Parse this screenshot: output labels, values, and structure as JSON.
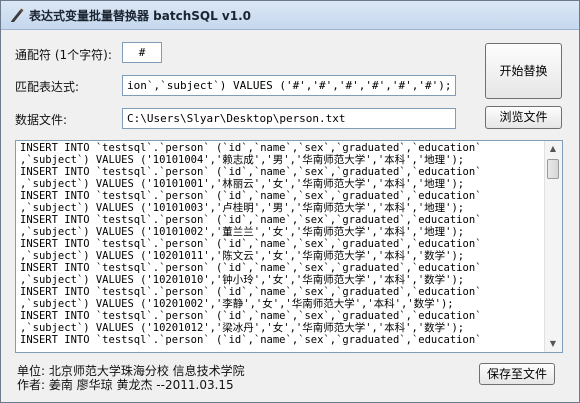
{
  "window": {
    "title": "表达式变量批量替换器 batchSQL v1.0"
  },
  "form": {
    "wildcard_label": "通配符 (1个字符):",
    "wildcard_value": "#",
    "pattern_label": "匹配表达式:",
    "pattern_value": "ion`,`subject`) VALUES ('#','#','#','#','#','#');",
    "datafile_label": "数据文件:",
    "datafile_value": "C:\\Users\\Slyar\\Desktop\\person.txt"
  },
  "buttons": {
    "start": "开始替换",
    "browse": "浏览文件",
    "save": "保存至文件"
  },
  "output": {
    "lines": [
      "INSERT INTO `testsql`.`person` (`id`,`name`,`sex`,`graduated`,`education`",
      ",`subject`) VALUES ('10101004','赖志成','男','华南师范大学','本科','地理');",
      "INSERT INTO `testsql`.`person` (`id`,`name`,`sex`,`graduated`,`education`",
      ",`subject`) VALUES ('10101001','林丽云','女','华南师范大学','本科','地理');",
      "INSERT INTO `testsql`.`person` (`id`,`name`,`sex`,`graduated`,`education`",
      ",`subject`) VALUES ('10101003','卢桂明','男','华南师范大学','本科','地理');",
      "INSERT INTO `testsql`.`person` (`id`,`name`,`sex`,`graduated`,`education`",
      ",`subject`) VALUES ('10101002','董兰兰','女','华南师范大学','本科','地理');",
      "INSERT INTO `testsql`.`person` (`id`,`name`,`sex`,`graduated`,`education`",
      ",`subject`) VALUES ('10201011','陈文云','女','华南师范大学','本科','数学');",
      "INSERT INTO `testsql`.`person` (`id`,`name`,`sex`,`graduated`,`education`",
      ",`subject`) VALUES ('10201010','钟小玲','女','华南师范大学','本科','数学');",
      "INSERT INTO `testsql`.`person` (`id`,`name`,`sex`,`graduated`,`education`",
      ",`subject`) VALUES ('10201002','李静','女','华南师范大学','本科','数学');",
      "INSERT INTO `testsql`.`person` (`id`,`name`,`sex`,`graduated`,`education`",
      ",`subject`) VALUES ('10201012','梁冰丹','女','华南师范大学','本科','数学');",
      "INSERT INTO `testsql`.`person` (`id`,`name`,`sex`,`graduated`,`education`"
    ]
  },
  "footer": {
    "unit": "单位: 北京师范大学珠海分校 信息技术学院",
    "authors": "作者: 姜南 廖华琼 黄龙杰   --2011.03.15"
  },
  "icons": {
    "app": "pen-icon",
    "scroll_up": "arrow-up-icon",
    "scroll_down": "arrow-down-icon"
  }
}
